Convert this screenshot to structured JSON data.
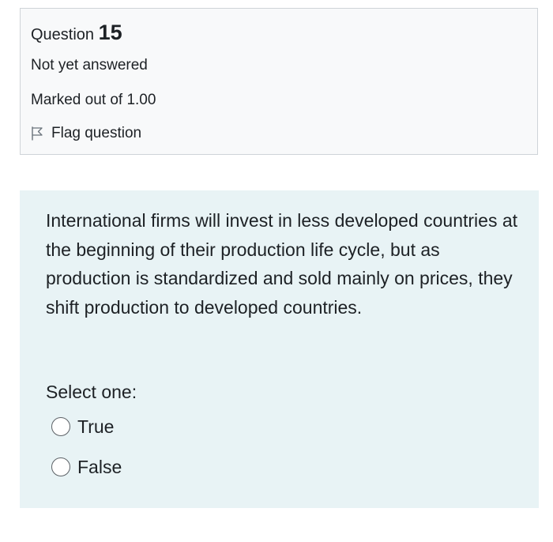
{
  "question_info": {
    "question_word": "Question",
    "question_number": "15",
    "state": "Not yet answered",
    "grade": "Marked out of 1.00",
    "flag_label": "Flag question",
    "flag_icon": "flag-outline-icon"
  },
  "formulation": {
    "question_text": "International firms will invest in less developed countries at the beginning of their production life cycle, but as production is standardized and sold mainly on prices, they shift production to developed countries.",
    "prompt": "Select one:",
    "options": [
      {
        "label": "True",
        "selected": false
      },
      {
        "label": "False",
        "selected": false
      }
    ]
  },
  "colors": {
    "info_background": "#f8f9fa",
    "info_border": "#cfd4d8",
    "formulation_background": "#e8f3f5",
    "text": "#1d2125"
  }
}
